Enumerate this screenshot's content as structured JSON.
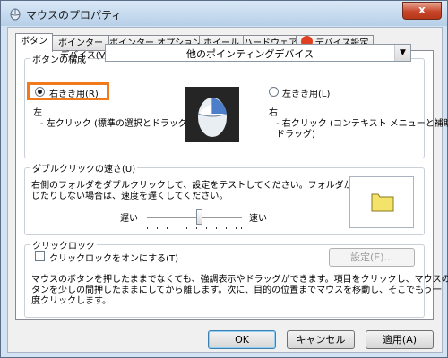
{
  "window": {
    "title": "マウスのプロパティ",
    "close_label": "x"
  },
  "tabs": [
    {
      "label": "ボタン"
    },
    {
      "label": "ポインター"
    },
    {
      "label": "ポインター オプション"
    },
    {
      "label": "ホイール"
    },
    {
      "label": "ハードウェア"
    },
    {
      "label": "デバイス設定"
    }
  ],
  "button_config": {
    "group_label": "ボタンの構成",
    "device_label": "デバイス(V):",
    "device_value": "他のポインティングデバイス",
    "right_handed_label": "右きき用(R)",
    "left_handed_label": "左きき用(L)",
    "left_title": "左",
    "left_desc": "- 左クリック (標準の選択とドラッグ)",
    "right_title": "右",
    "right_desc_line1": "- 右クリック (コンテキスト メニューと補助",
    "right_desc_line2": "ドラッグ)"
  },
  "double_click": {
    "group_label": "ダブルクリックの速さ(U)",
    "desc_line1": "右側のフォルダをダブルクリックして、設定をテストしてください。フォルダが開いたり閉",
    "desc_line2": "じたりしない場合は、速度を遅くしてください。",
    "slow_label": "遅い",
    "fast_label": "速い",
    "speed_fraction": 0.55
  },
  "click_lock": {
    "group_label": "クリックロック",
    "checkbox_label": "クリックロックをオンにする(T)",
    "settings_button": "設定(E)...",
    "desc_line1": "マウスのボタンを押したままでなくても、強調表示やドラッグができます。項目をクリックし、マウスのボ",
    "desc_line2": "タンを少しの間押したままにしてから離します。次に、目的の位置までマウスを移動し、そこでもう一",
    "desc_line3": "度クリックします。"
  },
  "footer": {
    "ok": "OK",
    "cancel": "キャンセル",
    "apply": "適用(A)"
  },
  "colors": {
    "highlight": "#f07a1c",
    "folder": "#f3e36b"
  }
}
